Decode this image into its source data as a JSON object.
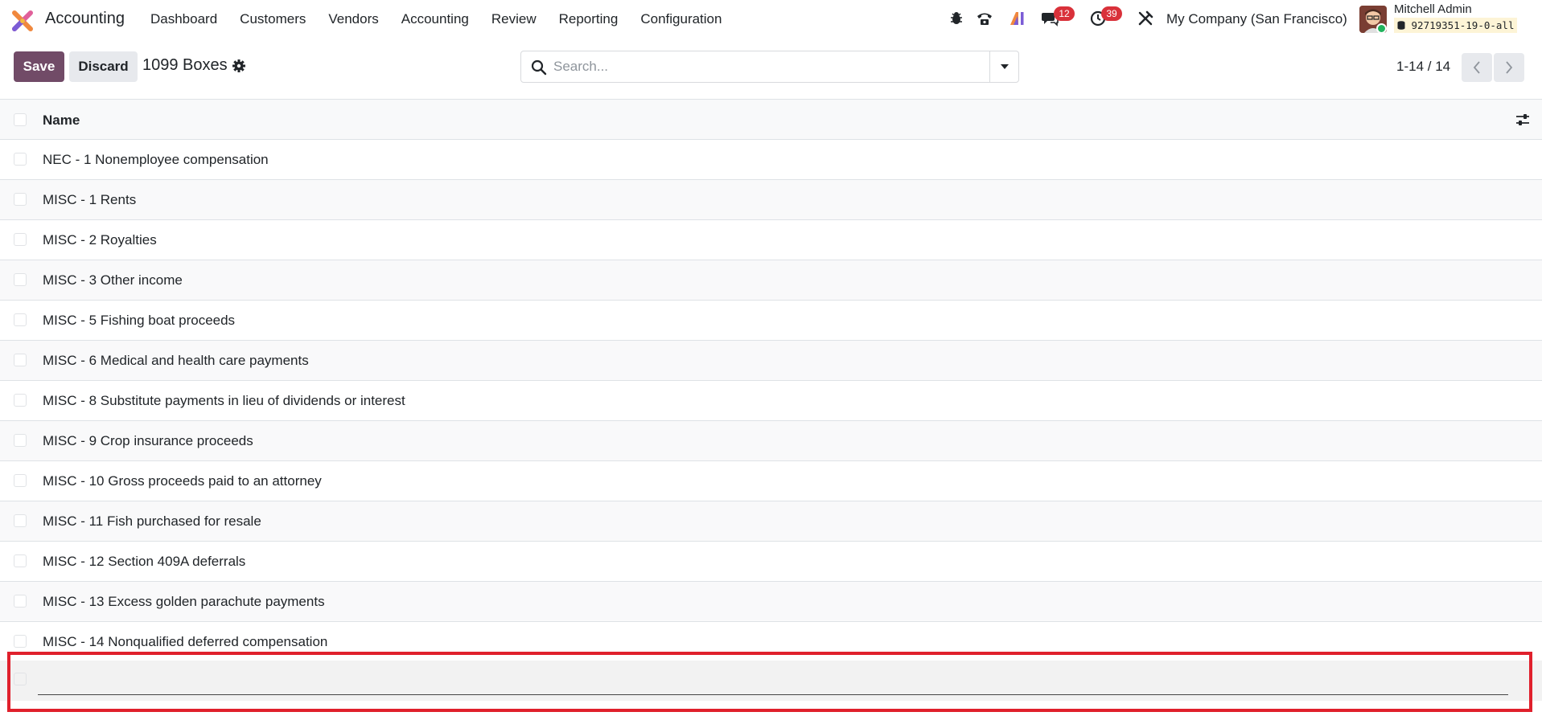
{
  "app": {
    "name": "Accounting"
  },
  "menu": [
    {
      "label": "Dashboard"
    },
    {
      "label": "Customers"
    },
    {
      "label": "Vendors"
    },
    {
      "label": "Accounting"
    },
    {
      "label": "Review"
    },
    {
      "label": "Reporting"
    },
    {
      "label": "Configuration"
    }
  ],
  "systray": {
    "messages_badge": "12",
    "activities_badge": "39",
    "company": "My Company (San Francisco)",
    "user_name": "Mitchell Admin",
    "db_name": "92719351-19-0-all"
  },
  "control": {
    "save_label": "Save",
    "discard_label": "Discard",
    "title": "1099 Boxes",
    "search_placeholder": "Search...",
    "pager": "1-14 / 14"
  },
  "list": {
    "header": "Name",
    "rows": [
      {
        "name": "NEC - 1 Nonemployee compensation"
      },
      {
        "name": "MISC - 1 Rents"
      },
      {
        "name": "MISC - 2 Royalties"
      },
      {
        "name": "MISC - 3 Other income"
      },
      {
        "name": "MISC - 5 Fishing boat proceeds"
      },
      {
        "name": "MISC - 6 Medical and health care payments"
      },
      {
        "name": "MISC - 8 Substitute payments in lieu of dividends or interest"
      },
      {
        "name": "MISC - 9 Crop insurance proceeds"
      },
      {
        "name": "MISC - 10 Gross proceeds paid to an attorney"
      },
      {
        "name": "MISC - 11 Fish purchased for resale"
      },
      {
        "name": "MISC - 12 Section 409A deferrals"
      },
      {
        "name": "MISC - 13 Excess golden parachute payments"
      },
      {
        "name": "MISC - 14 Nonqualified deferred compensation"
      }
    ],
    "new_row_value": ""
  },
  "colors": {
    "primary": "#714b67",
    "badge": "#d9313a",
    "highlight": "#e0202c"
  }
}
